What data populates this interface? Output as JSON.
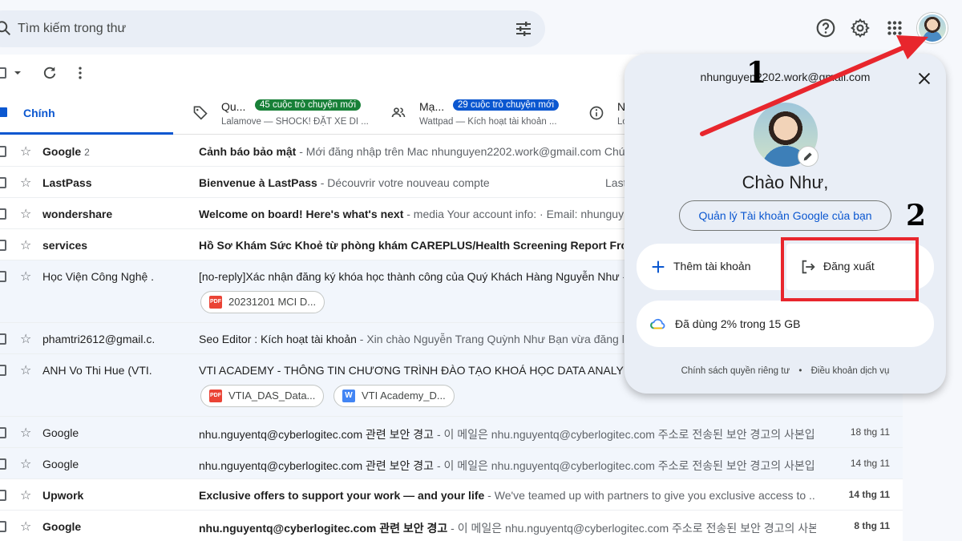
{
  "search": {
    "placeholder": "Tìm kiếm trong thư"
  },
  "tabs": [
    {
      "label": "Chính"
    },
    {
      "label": "Qu...",
      "badge": "45 cuộc trò chuyện mới",
      "badge_color": "#188038",
      "snippet": "Lalamove — SHOCK! ĐẶT XE DI ..."
    },
    {
      "label": "Mạ...",
      "badge": "29 cuộc trò chuyện mới",
      "badge_color": "#0b57d0",
      "snippet": "Wattpad — Kích hoạt tài khoản ..."
    },
    {
      "label": "N",
      "snippet": "Lo"
    }
  ],
  "emails": [
    {
      "sender": "Google",
      "count": "2",
      "subject": "Cảnh báo bảo mật",
      "snippet": " - Mới đăng nhập trên Mac nhunguyen2202.work@gmail.com Chú",
      "date": "",
      "unread": true
    },
    {
      "sender": "LastPass",
      "subject": "Bienvenue à LastPass",
      "snippet": " - Découvrir votre nouveau compte",
      "date": "Last",
      "unread": true
    },
    {
      "sender": "wondershare",
      "subject": "Welcome on board! Here's what's next",
      "snippet": " - media Your account info: · Email: nhunguye",
      "date": "",
      "unread": true
    },
    {
      "sender": "services",
      "subject": "Hồ Sơ Khám Sức Khoẻ từ phòng khám CAREPLUS/Health Screening Report From",
      "snippet": "",
      "date": "",
      "unread": true
    },
    {
      "sender": "Học Viện Công Nghệ .",
      "subject": "[no-reply]Xác nhận đăng ký khóa học thành công của Quý Khách Hàng Nguyễn Như",
      "snippet": " -",
      "date": "",
      "unread": false,
      "attachments": [
        {
          "name": "20231201 MCI D...",
          "type": "PDF"
        }
      ]
    },
    {
      "sender": "phamtri2612@gmail.c.",
      "subject": "Seo Editor : Kích hoạt tài khoản",
      "snippet": " - Xin chào Nguyễn Trang Quỳnh Như Bạn vừa đăng ký",
      "date": "",
      "unread": false
    },
    {
      "sender": "ANH Vo Thi Hue (VTI.",
      "subject": "VTI ACADEMY - THÔNG TIN CHƯƠNG TRÌNH ĐÀO TẠO KHOÁ HỌC DATA ANALYST (DA",
      "snippet": "",
      "date": "",
      "unread": false,
      "attachments": [
        {
          "name": "VTIA_DAS_Data...",
          "type": "PDF"
        },
        {
          "name": "VTI Academy_D...",
          "type": "W"
        }
      ]
    },
    {
      "sender": "Google",
      "subject": "nhu.nguyentq@cyberlogitec.com 관련 보안 경고",
      "snippet": " - 이 메일은 nhu.nguyentq@cyberlogitec.com 주소로 전송된 보안 경고의 사본입니...",
      "date": "18 thg 11",
      "unread": false
    },
    {
      "sender": "Google",
      "subject": "nhu.nguyentq@cyberlogitec.com 관련 보안 경고",
      "snippet": " - 이 메일은 nhu.nguyentq@cyberlogitec.com 주소로 전송된 보안 경고의 사본입니...",
      "date": "14 thg 11",
      "unread": false
    },
    {
      "sender": "Upwork",
      "subject": "Exclusive offers to support your work — and your life",
      "snippet": " - We've teamed up with partners to give you exclusive access to ...",
      "date": "14 thg 11",
      "unread": true
    },
    {
      "sender": "Google",
      "subject": "nhu.nguyentq@cyberlogitec.com 관련 보안 경고",
      "snippet": " - 이 메일은 nhu.nguyentq@cyberlogitec.com 주소로 전송된 보안 경고의 사본입니...",
      "date": "8 thg 11",
      "unread": true
    }
  ],
  "popup": {
    "email": "nhunguyen2202.work@gmail.com",
    "greeting": "Chào Như,",
    "manage_label": "Quản lý Tài khoản Google của bạn",
    "add_account_label": "Thêm tài khoản",
    "sign_out_label": "Đăng xuất",
    "storage_label": "Đã dùng 2% trong 15 GB",
    "privacy_label": "Chính sách quyền riêng tư",
    "separator": "•",
    "terms_label": "Điều khoản dịch vụ"
  },
  "annotations": {
    "step1": "1",
    "step2": "2",
    "highlight_color": "#e8262d"
  }
}
